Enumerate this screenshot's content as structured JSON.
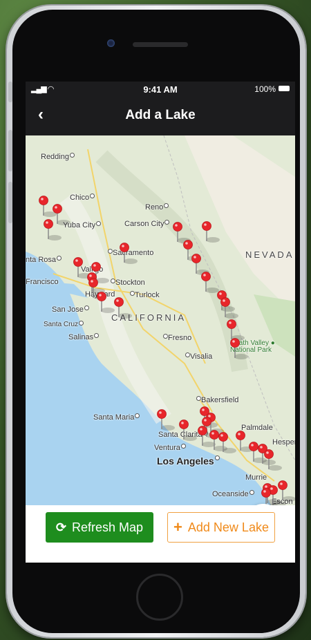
{
  "status_bar": {
    "time": "9:41 AM",
    "battery": "100%"
  },
  "nav": {
    "back_icon": "chevron-left-icon",
    "title": "Add a Lake"
  },
  "map": {
    "state_labels": [
      "NEVADA",
      "CALIFORNIA"
    ],
    "cities": {
      "redding": "Redding",
      "chico": "Chico",
      "reno": "Reno",
      "yuba_city": "Yuba City",
      "carson_city": "Carson City",
      "santa_rosa": "nta Rosa",
      "sacramento": "Sacramento",
      "san_francisco": "Francisco",
      "vallejo": "Vallejo",
      "stockton": "Stockton",
      "hayward": "Hayward",
      "turlock": "Turlock",
      "san_jose": "San Jose",
      "santa_cruz": "Santa Cruz",
      "salinas": "Salinas",
      "fresno": "Fresno",
      "visalia": "Visalia",
      "bakersfield": "Bakersfield",
      "santa_maria": "Santa Maria",
      "santa_clarita": "Santa Clarita",
      "palmdale": "Palmdale",
      "hesperia": "Hesperia",
      "ventura": "Ventura",
      "los_angeles": "Los Angeles",
      "murrieta": "Murrie",
      "oceanside": "Oceanside",
      "escondido": "Escon"
    },
    "park": {
      "line1": "Death Valley",
      "line2": "National Park"
    },
    "search_icon": "search-icon"
  },
  "actions": {
    "refresh_label": "Refresh Map",
    "refresh_icon": "refresh-icon",
    "add_label": "Add New Lake",
    "add_icon": "plus-icon"
  },
  "colors": {
    "nav_bg": "#1c1c1e",
    "pin": "#e8262b",
    "refresh_bg": "#1e8d1e",
    "add_accent": "#f08a1a",
    "search_accent": "#1e6fd6"
  }
}
